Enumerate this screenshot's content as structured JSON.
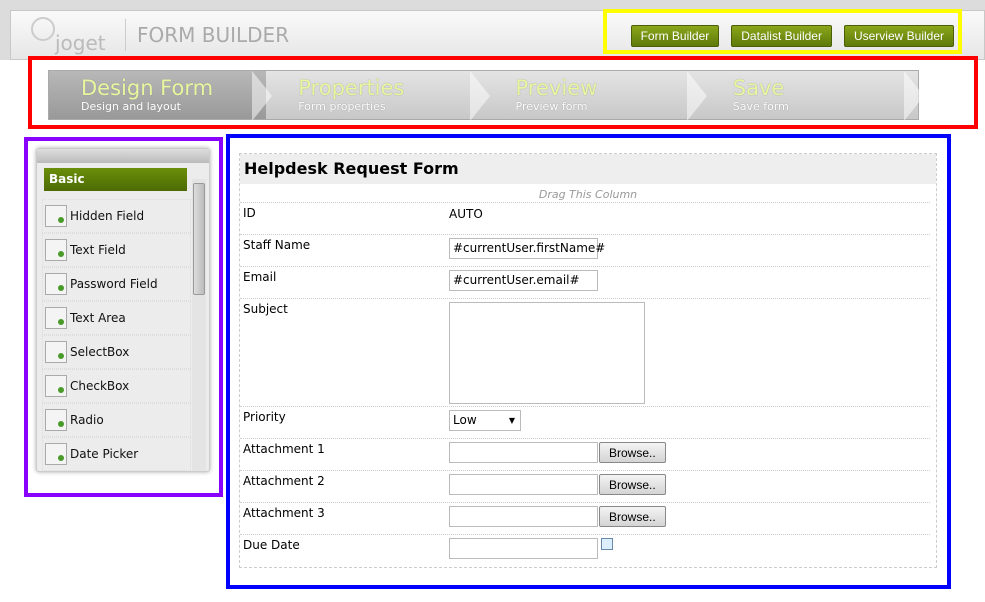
{
  "header": {
    "logo": "joget",
    "title": "FORM BUILDER",
    "buttons": [
      "Form Builder",
      "Datalist Builder",
      "Userview Builder"
    ]
  },
  "steps": [
    {
      "name": "Design Form",
      "sub": "Design and layout"
    },
    {
      "name": "Properties",
      "sub": "Form properties"
    },
    {
      "name": "Preview",
      "sub": "Preview form"
    },
    {
      "name": "Save",
      "sub": "Save form"
    }
  ],
  "palette": {
    "category": "Basic",
    "items": [
      "Hidden Field",
      "Text Field",
      "Password Field",
      "Text Area",
      "SelectBox",
      "CheckBox",
      "Radio",
      "Date Picker"
    ]
  },
  "form": {
    "title": "Helpdesk Request Form",
    "drag_hint": "Drag This Column",
    "fields": {
      "id_label": "ID",
      "id_value": "AUTO",
      "staff_label": "Staff Name",
      "staff_value": "#currentUser.firstName#",
      "email_label": "Email",
      "email_value": "#currentUser.email#",
      "subject_label": "Subject",
      "priority_label": "Priority",
      "priority_value": "Low",
      "att1": "Attachment 1",
      "att2": "Attachment 2",
      "att3": "Attachment 3",
      "browse": "Browse..",
      "due_label": "Due Date"
    }
  }
}
